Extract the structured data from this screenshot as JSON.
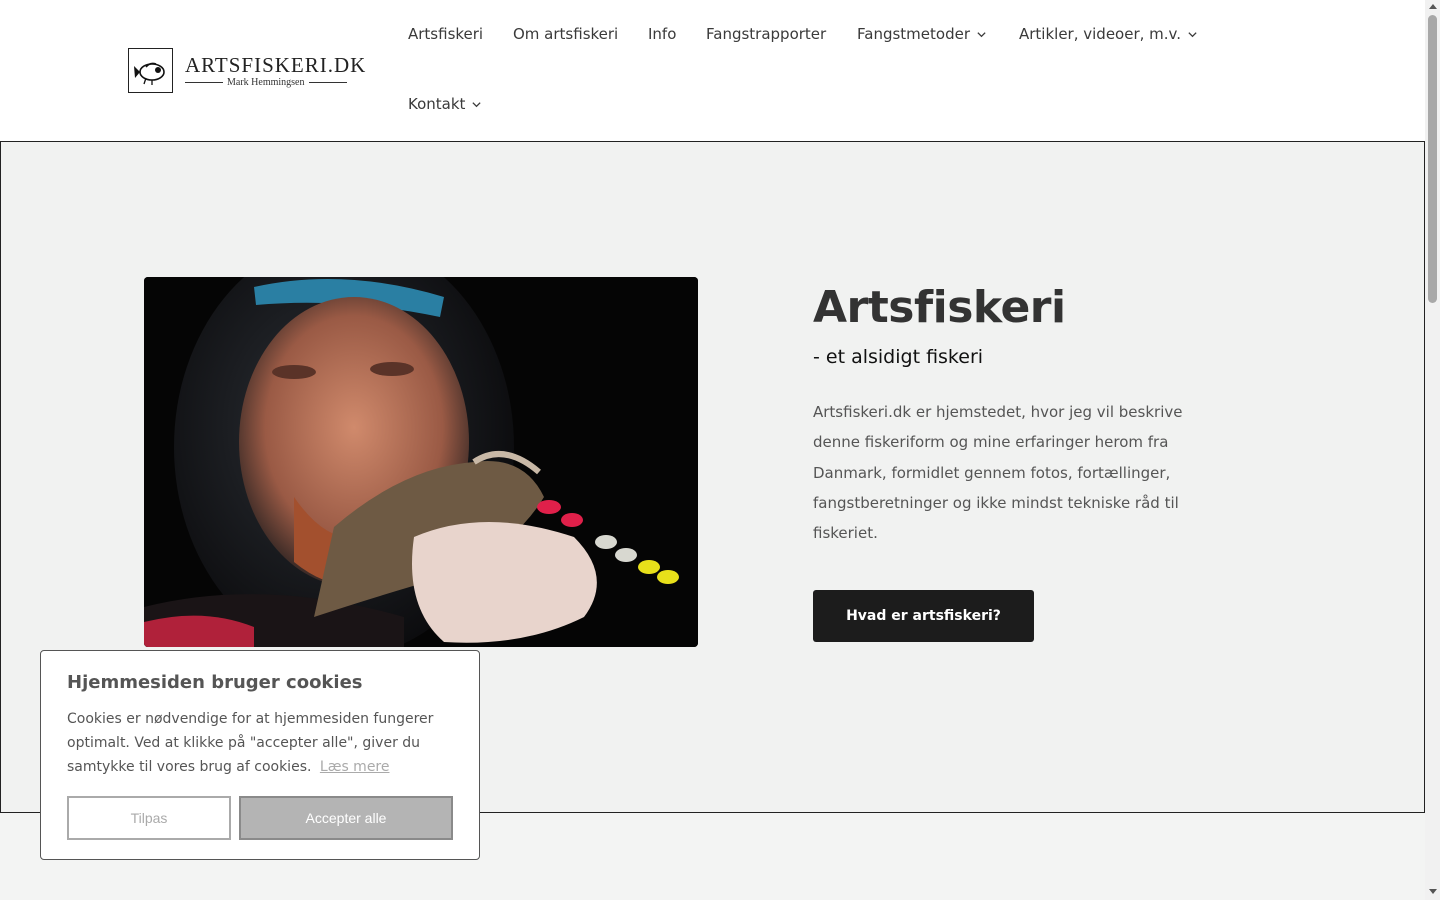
{
  "header": {
    "logo": {
      "title": "ARTSFISKERI.DK",
      "subtitle": "Mark Hemmingsen"
    },
    "nav": [
      {
        "label": "Artsfiskeri"
      },
      {
        "label": "Om artsfiskeri"
      },
      {
        "label": "Info"
      },
      {
        "label": "Fangstrapporter"
      },
      {
        "label": "Fangstmetoder",
        "dropdown": true
      },
      {
        "label": "Artikler, videoer, m.v.",
        "dropdown": true
      },
      {
        "label": "Kontakt",
        "dropdown": true
      }
    ]
  },
  "hero": {
    "image_description": "photo",
    "title": "Artsfiskeri",
    "subtitle": "- et alsidigt fiskeri",
    "body": "Artsfiskeri.dk er hjemstedet, hvor jeg vil beskrive denne fiskeriform og mine erfaringer herom fra Danmark, formidlet gennem fotos, fortællinger, fangstberetninger og ikke mindst tekniske råd til fiskeriet.",
    "cta_label": "Hvad er artsfiskeri?"
  },
  "cookie_banner": {
    "title": "Hjemmesiden bruger cookies",
    "text": "Cookies er nødvendige for at hjemmesiden fungerer optimalt. Ved at klikke på \"accepter alle\", giver du samtykke til vores brug af cookies.",
    "link_label": "Læs mere",
    "customize_label": "Tilpas",
    "accept_label": "Accepter alle"
  },
  "colors": {
    "header_bg": "#ffffff",
    "hero_bg": "#f1f2f1",
    "cta_bg": "#1c1c1c",
    "accept_bg": "#b4b4b4"
  },
  "icons": [
    "fish-logo-icon",
    "chevron-down-icon"
  ]
}
